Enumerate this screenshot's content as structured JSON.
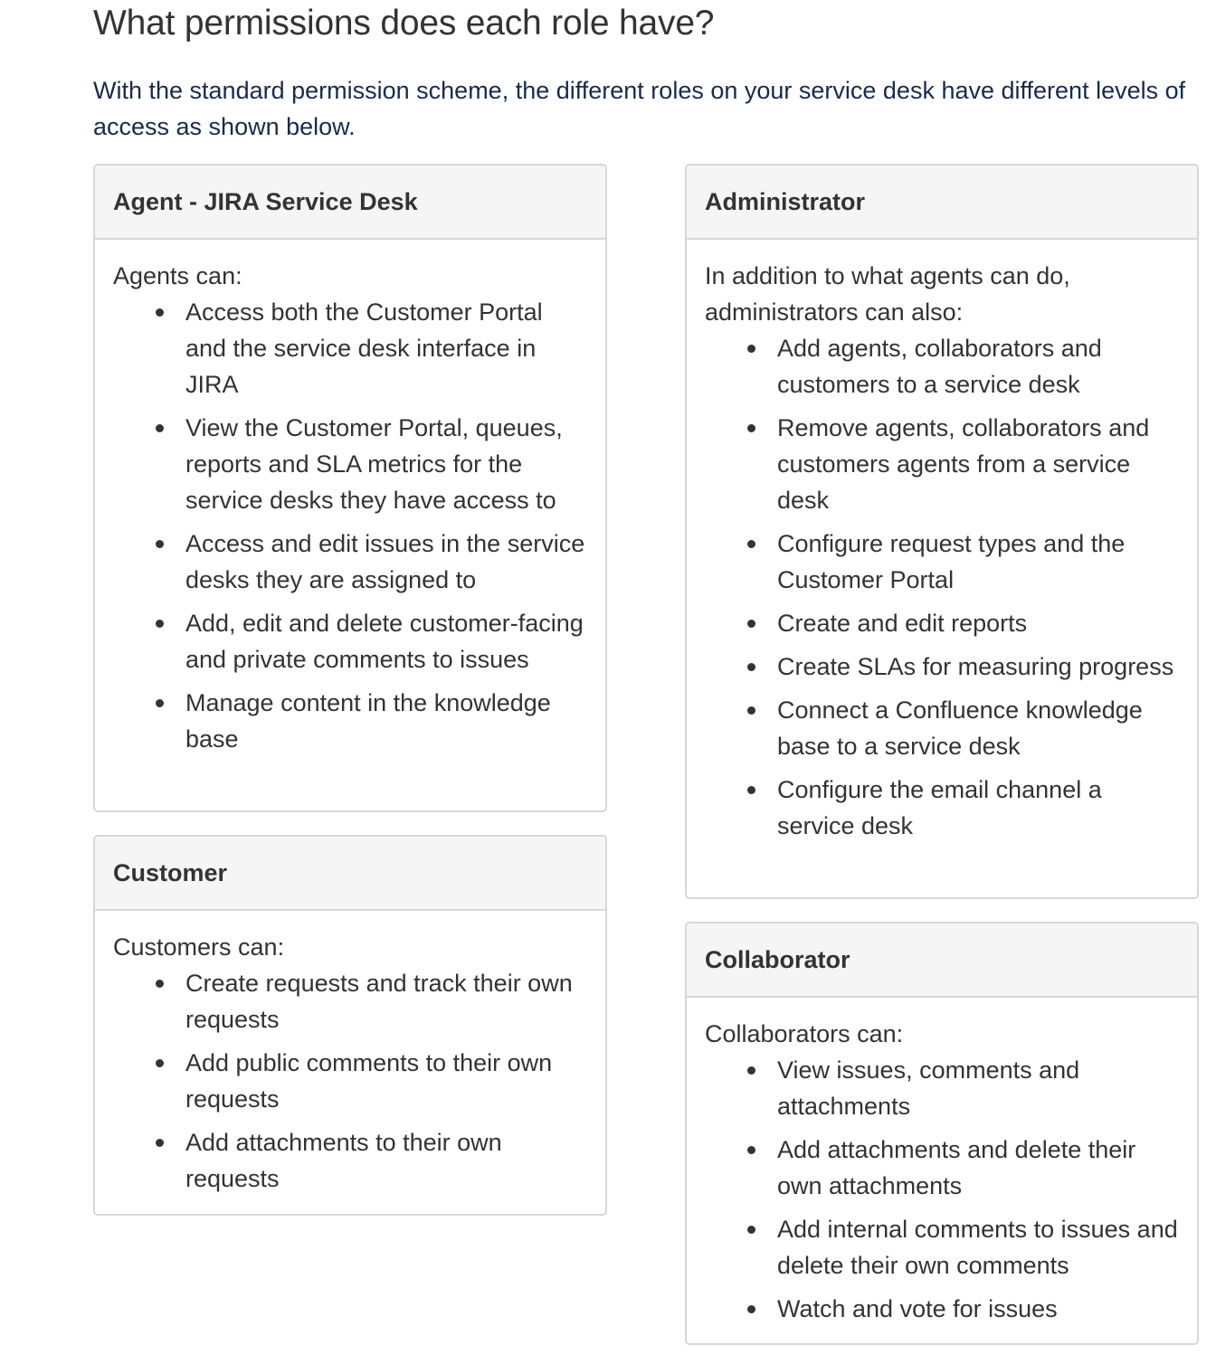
{
  "page": {
    "title": "What permissions does each role have?",
    "intro": "With the standard permission scheme, the different roles on your service desk have different levels of access as shown below."
  },
  "panels": {
    "agent": {
      "title": "Agent - JIRA Service Desk",
      "intro": "Agents can:",
      "items": [
        "Access both the Customer Portal and the service desk interface in JIRA",
        "View the Customer Portal, queues, reports and SLA metrics for the service desks they have access to",
        "Access and edit issues in the service desks they are assigned to",
        "Add, edit and delete customer-facing and private comments to issues",
        "Manage content in the knowledge base"
      ]
    },
    "customer": {
      "title": "Customer",
      "intro": "Customers can:",
      "items": [
        "Create requests and track their own requests",
        "Add public comments to their own requests",
        "Add attachments to their own requests"
      ]
    },
    "administrator": {
      "title": "Administrator",
      "intro": "In addition to what agents can do, administrators can also:",
      "items": [
        "Add agents, collaborators and customers to a service desk",
        "Remove agents, collaborators and customers agents from a service desk",
        "Configure request types and the Customer Portal",
        "Create and edit reports",
        "Create SLAs for measuring progress",
        "Connect a Confluence knowledge base to a service desk",
        "Configure the email channel a service desk"
      ]
    },
    "collaborator": {
      "title": "Collaborator",
      "intro": "Collaborators can:",
      "items": [
        "View issues, comments and attachments",
        "Add attachments and delete their own attachments",
        "Add internal comments to issues and delete their own comments",
        "Watch and vote for issues"
      ]
    }
  },
  "icons": {
    "bullet": "bullet-dot"
  }
}
